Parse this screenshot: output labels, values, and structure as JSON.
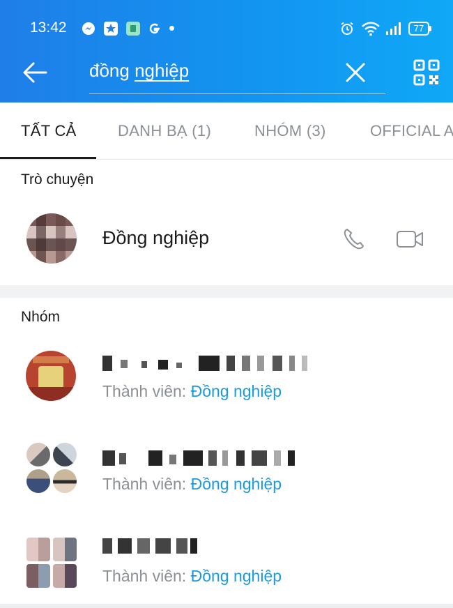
{
  "status_bar": {
    "time": "13:42",
    "battery": "77",
    "icons": [
      "messenger-icon",
      "star-app-icon",
      "green-app-icon",
      "google-icon",
      "alarm-icon",
      "wifi-icon",
      "signal-icon",
      "battery-icon"
    ]
  },
  "header": {
    "search_prefix": "đồng ",
    "search_highlight": "nghiệp",
    "back_icon": "arrow-left-icon",
    "clear_icon": "close-icon",
    "qr_icon": "qr-code-icon"
  },
  "tabs": [
    {
      "label": "TẤT CẢ",
      "active": true
    },
    {
      "label": "DANH BẠ (1)",
      "active": false
    },
    {
      "label": "NHÓM (3)",
      "active": false
    },
    {
      "label": "OFFICIAL A",
      "active": false
    }
  ],
  "chat_section": {
    "title": "Trò chuyện",
    "contact_name": "Đồng nghiệp"
  },
  "group_section": {
    "title": "Nhóm",
    "member_prefix": "Thành viên: ",
    "member_keyword": "Đồng nghiệp",
    "groups": [
      {
        "member_prefix": "Thành viên: ",
        "member_keyword": "Đồng nghiệp"
      },
      {
        "member_prefix": "Thành viên: ",
        "member_keyword": "Đồng nghiệp"
      },
      {
        "member_prefix": "Thành viên: ",
        "member_keyword": "Đồng nghiệp"
      }
    ]
  },
  "colors": {
    "header_start": "#1f7ee8",
    "header_end": "#10a8f7",
    "keyword": "#1a9be0",
    "muted_text": "#8a8f96"
  }
}
